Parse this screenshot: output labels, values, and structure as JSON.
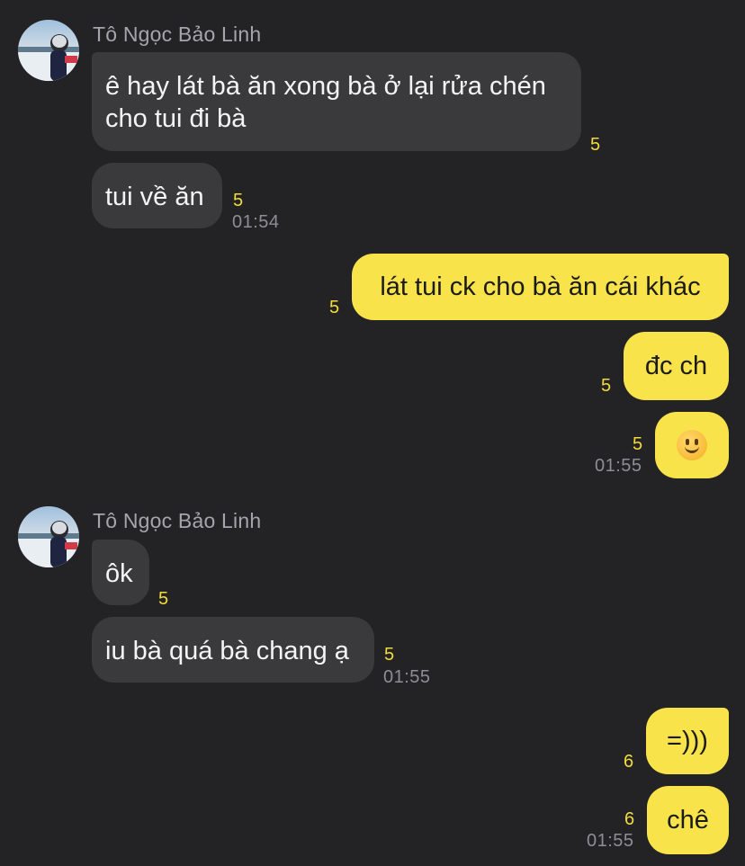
{
  "colors": {
    "background": "#232325",
    "incoming_bubble": "#3a3a3c",
    "outgoing_bubble": "#f8e34b",
    "unread_count": "#f2dc3c",
    "timestamp": "#8e8e93"
  },
  "groups": [
    {
      "sender": "Tô Ngọc Bảo Linh",
      "avatar_icon": "profile-photo-avatar",
      "messages": [
        {
          "text": "ê hay lát bà ăn xong bà ở lại rửa chén cho tui đi bà",
          "count": "5"
        },
        {
          "text": "tui về ăn",
          "count": "5",
          "time": "01:54"
        }
      ]
    },
    {
      "direction": "outgoing",
      "messages": [
        {
          "text": "lát tui ck cho bà ăn cái khác",
          "count": "5"
        },
        {
          "text": "đc ch",
          "count": "5"
        },
        {
          "emoji": "slightly-smiling-face-emoji",
          "count": "5",
          "time": "01:55"
        }
      ]
    },
    {
      "sender": "Tô Ngọc Bảo Linh",
      "avatar_icon": "profile-photo-avatar",
      "messages": [
        {
          "text": "ôk",
          "count": "5"
        },
        {
          "text": "iu bà quá bà chang ạ",
          "count": "5",
          "time": "01:55"
        }
      ]
    },
    {
      "direction": "outgoing",
      "messages": [
        {
          "text": "=)))",
          "count": "6"
        },
        {
          "text": "chê",
          "count": "6",
          "time": "01:55"
        }
      ]
    }
  ]
}
